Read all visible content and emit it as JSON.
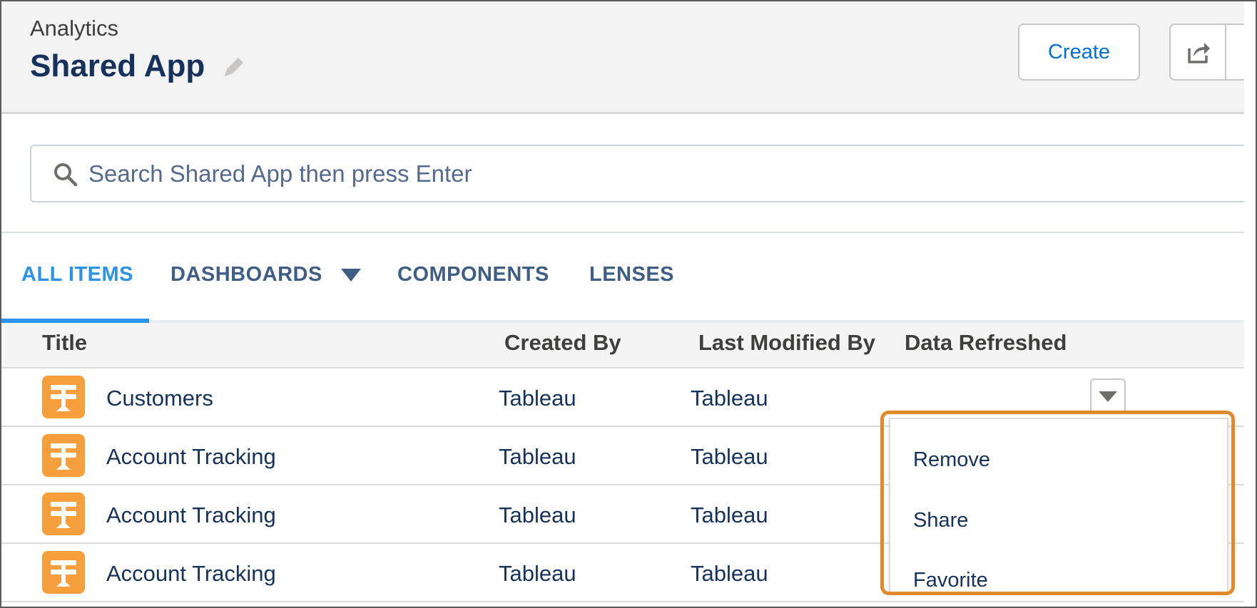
{
  "header": {
    "eyebrow": "Analytics",
    "title": "Shared App",
    "create_label": "Create"
  },
  "search": {
    "placeholder": "Search Shared App then press Enter"
  },
  "tabs": [
    {
      "label": "ALL ITEMS",
      "active": true
    },
    {
      "label": "DASHBOARDS",
      "active": false
    },
    {
      "label": "COMPONENTS",
      "active": false
    },
    {
      "label": "LENSES",
      "active": false
    }
  ],
  "table": {
    "columns": [
      "Title",
      "Created By",
      "Last Modified By",
      "Data Refreshed"
    ],
    "rows": [
      {
        "title": "Customers",
        "created_by": "Tableau",
        "last_modified_by": "Tableau"
      },
      {
        "title": "Account Tracking",
        "created_by": "Tableau",
        "last_modified_by": "Tableau"
      },
      {
        "title": "Account Tracking",
        "created_by": "Tableau",
        "last_modified_by": "Tableau"
      },
      {
        "title": "Account Tracking",
        "created_by": "Tableau",
        "last_modified_by": "Tableau"
      }
    ]
  },
  "row_menu": {
    "items": [
      "Remove",
      "Share",
      "Favorite"
    ]
  },
  "colors": {
    "accent": "#2b93e8",
    "highlight": "#e08a2a",
    "app_icon": "#f89f3d"
  },
  "icons": {
    "edit": "pencil-icon",
    "share": "share-icon",
    "search": "search-icon",
    "row": "signpost-icon",
    "menu_trigger": "chevron-down-icon"
  }
}
